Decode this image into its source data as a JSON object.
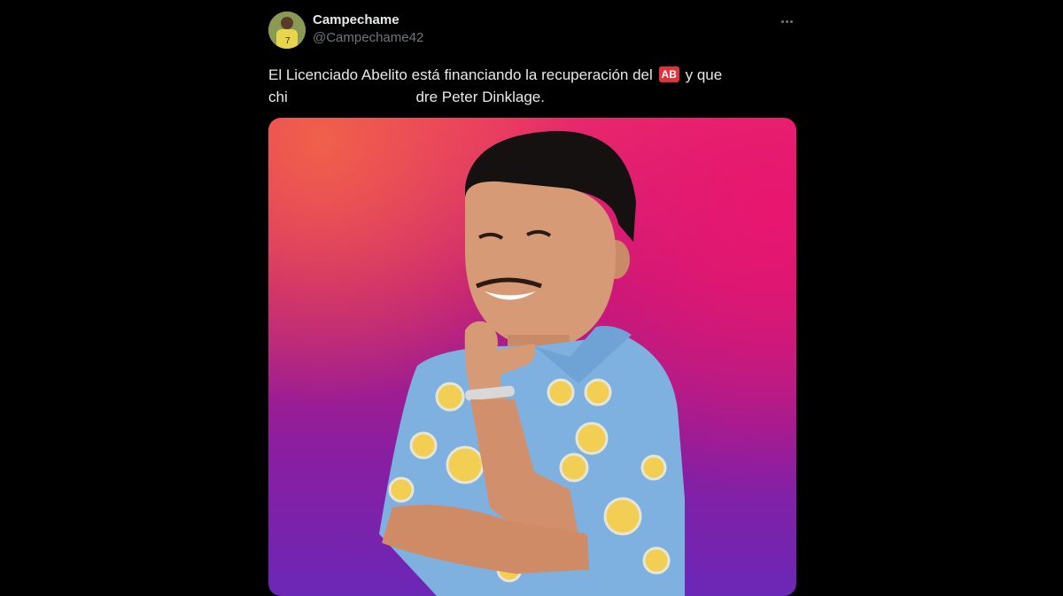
{
  "tweet": {
    "display_name": "Campechame",
    "handle": "@Campechame42",
    "text_line1_a": "El Licenciado Abelito está financiando la recuperación del",
    "badge": "AB",
    "text_line1_b": "y que",
    "text_line2_a": "chi",
    "text_line2_b": "dre Peter Dinklage.",
    "more_icon": "more-horizontal-icon"
  },
  "colors": {
    "background": "#000000",
    "text": "#e7e9ea",
    "secondary_text": "#71767b",
    "badge": "#e0313c"
  }
}
